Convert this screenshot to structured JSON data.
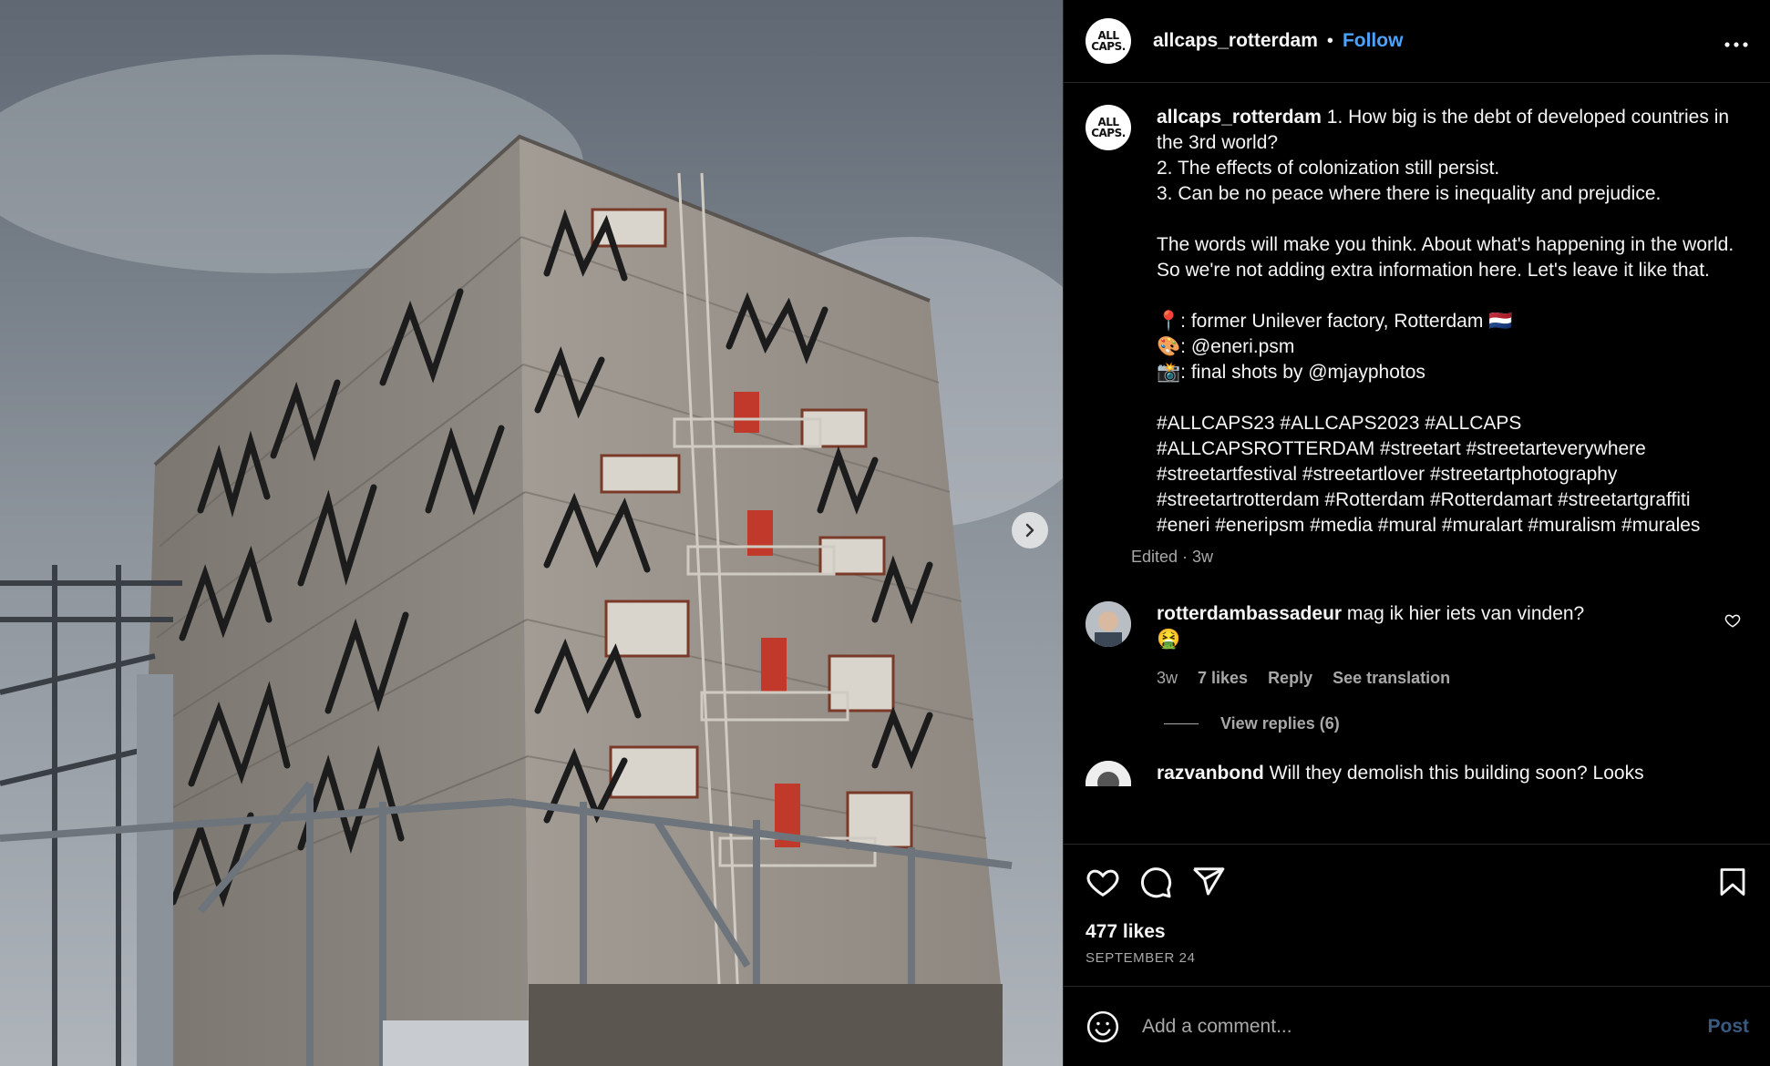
{
  "header": {
    "username": "allcaps_rotterdam",
    "separator": "•",
    "follow_label": "Follow",
    "more_icon": "more-horizontal-icon",
    "avatar_text": "ALL CAPS."
  },
  "caption": {
    "username": "allcaps_rotterdam",
    "text": "1. How big is the debt of developed countries in the 3rd world?\n2. The effects of colonization still persist.\n3. Can be no peace where there is inequality and prejudice.\n\nThe words will make you think. About what's happening in the world. So we're not adding extra information here. Let's leave it like that.\n\n📍: former Unilever factory, Rotterdam 🇳🇱\n🎨: @eneri.psm\n📸: final shots by @mjayphotos\n\n#ALLCAPS23 #ALLCAPS2023 #ALLCAPS #ALLCAPSROTTERDAM #streetart #streetarteverywhere #streetartfestival #streetartlover #streetartphotography #streetartrotterdam #Rotterdam #Rotterdamart #streetartgraffiti #eneri #eneripsm #media #mural #muralart #muralism #murales",
    "meta": "Edited · 3w"
  },
  "comments": [
    {
      "username": "rotterdambassadeur",
      "text": "mag ik hier iets van vinden?\n🤮",
      "time": "3w",
      "likes": "7 likes",
      "reply": "Reply",
      "translate": "See translation",
      "view_replies": "View replies (6)"
    },
    {
      "username": "razvanbond",
      "text": "Will they demolish this building soon? Looks"
    }
  ],
  "actions": {
    "like_icon": "heart-icon",
    "comment_icon": "comment-icon",
    "share_icon": "send-icon",
    "save_icon": "bookmark-icon",
    "likes": "477 likes",
    "date": "SEPTEMBER 24"
  },
  "add_comment": {
    "placeholder": "Add a comment...",
    "post_label": "Post"
  },
  "colors": {
    "background": "#000000",
    "link": "#4ca3ff",
    "muted": "#a8a8a8"
  }
}
